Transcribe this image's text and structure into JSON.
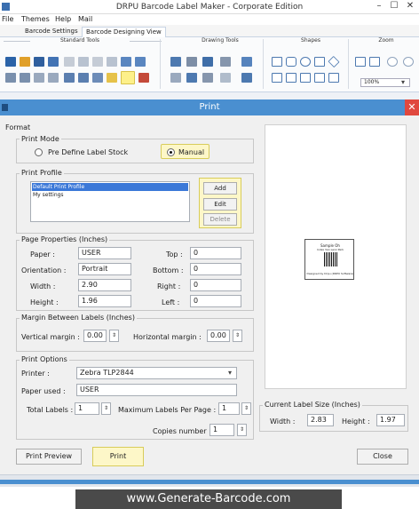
{
  "window": {
    "title": "DRPU Barcode Label Maker - Corporate Edition",
    "minimize": "–",
    "maximize": "☐",
    "close": "✕"
  },
  "menu": {
    "file": "File",
    "themes": "Themes",
    "help": "Help",
    "mail": "Mail"
  },
  "ribbon_tabs": [
    "Barcode Settings",
    "Barcode Designing View"
  ],
  "ribbon_groups": {
    "standard": "Standard Tools",
    "drawing": "Drawing Tools",
    "shapes": "Shapes",
    "zoom": "Zoom"
  },
  "zoom_value": "100%",
  "dialog": {
    "title": "Print",
    "close": "✕"
  },
  "format_label": "Format",
  "print_mode": {
    "label": "Print Mode",
    "option_predefine": "Pre Define Label Stock",
    "option_manual": "Manual",
    "selected": "Manual"
  },
  "print_profile": {
    "label": "Print Profile",
    "items": [
      "Default Print Profile",
      "My settings"
    ],
    "selected_index": 0,
    "add": "Add",
    "edit": "Edit",
    "delete": "Delete"
  },
  "page_properties": {
    "label": "Page Properties (Inches)",
    "paper_label": "Paper :",
    "paper_value": "USER",
    "orientation_label": "Orientation :",
    "orientation_value": "Portrait",
    "width_label": "Width :",
    "width_value": "2.90",
    "height_label": "Height :",
    "height_value": "1.96",
    "top_label": "Top :",
    "top_value": "0",
    "bottom_label": "Bottom :",
    "bottom_value": "0",
    "right_label": "Right :",
    "right_value": "0",
    "left_label": "Left :",
    "left_value": "0"
  },
  "margin_between": {
    "label": "Margin Between Labels (Inches)",
    "vertical_label": "Vertical margin :",
    "vertical_value": "0.00",
    "horizontal_label": "Horizontal margin :",
    "horizontal_value": "0.00"
  },
  "print_options": {
    "label": "Print Options",
    "printer_label": "Printer :",
    "printer_value": "Zebra TLP2844",
    "paper_used_label": "Paper used :",
    "paper_used_value": "USER",
    "total_labels_label": "Total Labels :",
    "total_labels_value": "1",
    "max_per_page_label": "Maximum Labels Per Page :",
    "max_per_page_value": "1",
    "copies_label": "Copies number :",
    "copies_value": "1"
  },
  "current_size": {
    "label": "Current Label Size (Inches)",
    "width_label": "Width :",
    "width_value": "2.83",
    "height_label": "Height :",
    "height_value": "1.97"
  },
  "preview_label": {
    "line1": "Sample Oh",
    "line2": "Index Van Lexx Park",
    "line3": "Designed by Drpu (DRPU Software)"
  },
  "buttons": {
    "print_preview": "Print Preview",
    "print": "Print",
    "close": "Close"
  },
  "spin_glyph": "⇕",
  "watermark": "www.Generate-Barcode.com",
  "colors": {
    "accent": "#4a8fd0",
    "highlight": "#fdf7c8",
    "close_red": "#e0483e"
  }
}
